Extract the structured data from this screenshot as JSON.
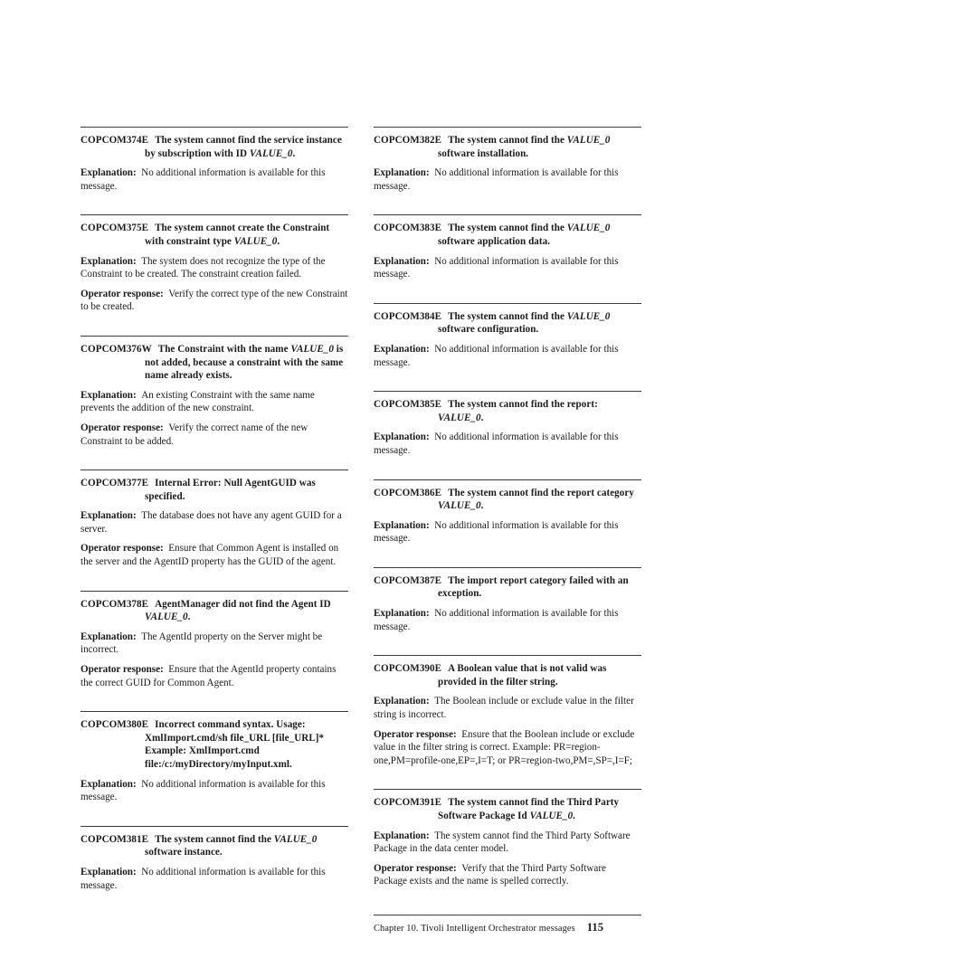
{
  "document": {
    "page_number": "115",
    "footer_text": "Chapter 10. Tivoli Intelligent Orchestrator messages"
  },
  "left_column": {
    "entries": [
      {
        "id": "COPCOM374E",
        "title_part1": "The system cannot find the service instance by subscription with ID ",
        "title_var": "VALUE_0",
        "title_part2": ".",
        "explanation_label": "Explanation:",
        "explanation_text": "No additional information is available for this message.",
        "operator_label": "",
        "operator_text": ""
      },
      {
        "id": "COPCOM375E",
        "title_part1": "The system cannot create the Constraint with constraint type ",
        "title_var": "VALUE_0",
        "title_part2": ".",
        "explanation_label": "Explanation:",
        "explanation_text": "The system does not recognize the type of the Constraint to be created. The constraint creation failed.",
        "operator_label": "Operator response:",
        "operator_text": "Verify the correct type of the new Constraint to be created."
      },
      {
        "id": "COPCOM376W",
        "title_part1": "The Constraint with the name ",
        "title_var": "VALUE_0",
        "title_part2": " is not added, because a constraint with the same name already exists.",
        "explanation_label": "Explanation:",
        "explanation_text": "An existing Constraint with the same name prevents the addition of the new constraint.",
        "operator_label": "Operator response:",
        "operator_text": "Verify the correct name of the new Constraint to be added."
      },
      {
        "id": "COPCOM377E",
        "title_part1": "Internal Error: Null AgentGUID was specified.",
        "title_var": "",
        "title_part2": "",
        "explanation_label": "Explanation:",
        "explanation_text": "The database does not have any agent GUID for a server.",
        "operator_label": "Operator response:",
        "operator_text": "Ensure that Common Agent is installed on the server and the AgentID property has the GUID of the agent."
      },
      {
        "id": "COPCOM378E",
        "title_part1": "AgentManager did not find the Agent ID ",
        "title_var": "VALUE_0",
        "title_part2": ".",
        "explanation_label": "Explanation:",
        "explanation_text": "The AgentId property on the Server might be incorrect.",
        "operator_label": "Operator response:",
        "operator_text": "Ensure that the AgentId property contains the correct GUID for Common Agent."
      },
      {
        "id": "COPCOM380E",
        "title_part1": "Incorrect command syntax. Usage: XmlImport.cmd/sh file_URL [file_URL]* Example: XmlImport.cmd file:/c:/myDirectory/myInput.xml.",
        "title_var": "",
        "title_part2": "",
        "explanation_label": "Explanation:",
        "explanation_text": "No additional information is available for this message.",
        "operator_label": "",
        "operator_text": ""
      },
      {
        "id": "COPCOM381E",
        "title_part1": "The system cannot find the ",
        "title_var": "VALUE_0",
        "title_part2": " software instance.",
        "explanation_label": "Explanation:",
        "explanation_text": "No additional information is available for this message.",
        "operator_label": "",
        "operator_text": ""
      }
    ]
  },
  "right_column": {
    "entries": [
      {
        "id": "COPCOM382E",
        "title_part1": "The system cannot find the ",
        "title_var": "VALUE_0",
        "title_part2": " software installation.",
        "explanation_label": "Explanation:",
        "explanation_text": "No additional information is available for this message.",
        "operator_label": "",
        "operator_text": ""
      },
      {
        "id": "COPCOM383E",
        "title_part1": "The system cannot find the ",
        "title_var": "VALUE_0",
        "title_part2": " software application data.",
        "explanation_label": "Explanation:",
        "explanation_text": "No additional information is available for this message.",
        "operator_label": "",
        "operator_text": ""
      },
      {
        "id": "COPCOM384E",
        "title_part1": "The system cannot find the ",
        "title_var": "VALUE_0",
        "title_part2": " software configuration.",
        "explanation_label": "Explanation:",
        "explanation_text": "No additional information is available for this message.",
        "operator_label": "",
        "operator_text": ""
      },
      {
        "id": "COPCOM385E",
        "title_part1": "The system cannot find the report: ",
        "title_var": "VALUE_0",
        "title_part2": ".",
        "explanation_label": "Explanation:",
        "explanation_text": "No additional information is available for this message.",
        "operator_label": "",
        "operator_text": ""
      },
      {
        "id": "COPCOM386E",
        "title_part1": "The system cannot find the report category ",
        "title_var": "VALUE_0",
        "title_part2": ".",
        "explanation_label": "Explanation:",
        "explanation_text": "No additional information is available for this message.",
        "operator_label": "",
        "operator_text": ""
      },
      {
        "id": "COPCOM387E",
        "title_part1": "The import report category failed with an exception.",
        "title_var": "",
        "title_part2": "",
        "explanation_label": "Explanation:",
        "explanation_text": "No additional information is available for this message.",
        "operator_label": "",
        "operator_text": ""
      },
      {
        "id": "COPCOM390E",
        "title_part1": "A Boolean value that is not valid was provided in the filter string.",
        "title_var": "",
        "title_part2": "",
        "explanation_label": "Explanation:",
        "explanation_text": "The Boolean include or exclude value in the filter string is incorrect.",
        "operator_label": "Operator response:",
        "operator_text": "Ensure that the Boolean include or exclude value in the filter string is correct. Example: PR=region-one,PM=profile-one,EP=,I=T; or PR=region-two,PM=,SP=,I=F;"
      },
      {
        "id": "COPCOM391E",
        "title_part1": "The system cannot find the Third Party Software Package Id ",
        "title_var": "VALUE_0",
        "title_part2": ".",
        "explanation_label": "Explanation:",
        "explanation_text": "The system cannot find the Third Party Software Package in the data center model.",
        "operator_label": "Operator response:",
        "operator_text": "Verify that the Third Party Software Package exists and the name is spelled correctly."
      }
    ]
  }
}
